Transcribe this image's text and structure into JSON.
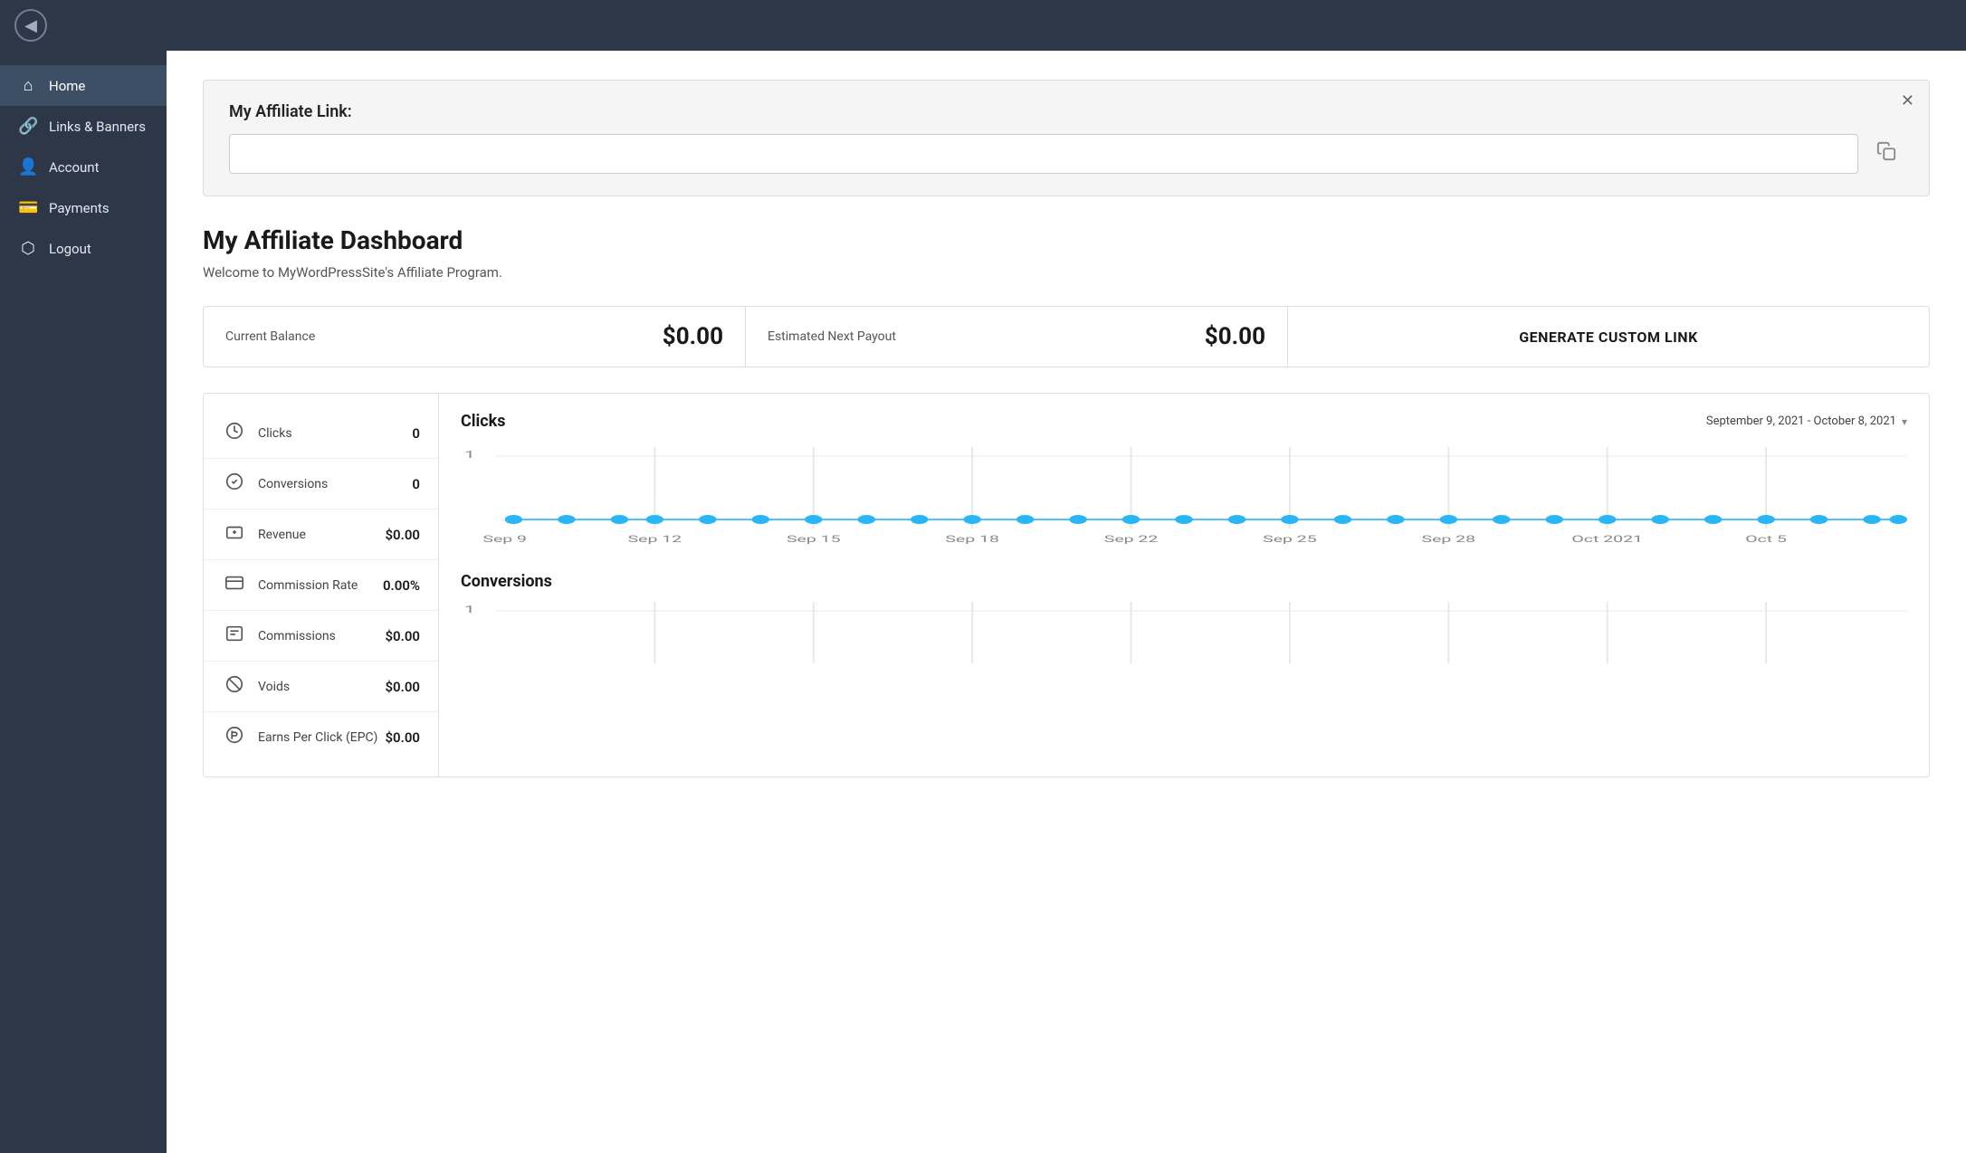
{
  "topbar": {
    "back_icon": "◀"
  },
  "sidebar": {
    "items": [
      {
        "id": "home",
        "label": "Home",
        "icon": "⌂",
        "active": true
      },
      {
        "id": "links-banners",
        "label": "Links & Banners",
        "icon": "🔗",
        "active": false
      },
      {
        "id": "account",
        "label": "Account",
        "icon": "👤",
        "active": false
      },
      {
        "id": "payments",
        "label": "Payments",
        "icon": "💳",
        "active": false
      },
      {
        "id": "logout",
        "label": "Logout",
        "icon": "⬡",
        "active": false
      }
    ]
  },
  "affiliate_link": {
    "label": "My Affiliate Link:",
    "input_value": "",
    "input_placeholder": ""
  },
  "dashboard": {
    "title": "My Affiliate Dashboard",
    "subtitle": "Welcome to MyWordPressSite's Affiliate Program."
  },
  "stats": {
    "current_balance_label": "Current Balance",
    "current_balance_value": "$0.00",
    "next_payout_label": "Estimated Next Payout",
    "next_payout_value": "$0.00",
    "generate_link_label": "GENERATE CUSTOM LINK"
  },
  "metrics": [
    {
      "id": "clicks",
      "icon": "⏱",
      "name": "Clicks",
      "value": "0"
    },
    {
      "id": "conversions",
      "icon": "💲",
      "name": "Conversions",
      "value": "0"
    },
    {
      "id": "revenue",
      "icon": "🏦",
      "name": "Revenue",
      "value": "$0.00"
    },
    {
      "id": "commission-rate",
      "icon": "💵",
      "name": "Commission Rate",
      "value": "0.00%"
    },
    {
      "id": "commissions",
      "icon": "📋",
      "name": "Commissions",
      "value": "$0.00"
    },
    {
      "id": "voids",
      "icon": "⊘",
      "name": "Voids",
      "value": "$0.00"
    },
    {
      "id": "epc",
      "icon": "💱",
      "name": "Earns Per Click (EPC)",
      "value": "$0.00"
    }
  ],
  "chart": {
    "clicks_title": "Clicks",
    "conversions_title": "Conversions",
    "date_range": "September 9, 2021 - October 8, 2021",
    "x_labels": [
      "Sep 9",
      "Sep 12",
      "Sep 15",
      "Sep 18",
      "Sep 22",
      "Sep 25",
      "Sep 28",
      "Oct 2021",
      "Oct 5"
    ],
    "y_label_top": "1"
  }
}
